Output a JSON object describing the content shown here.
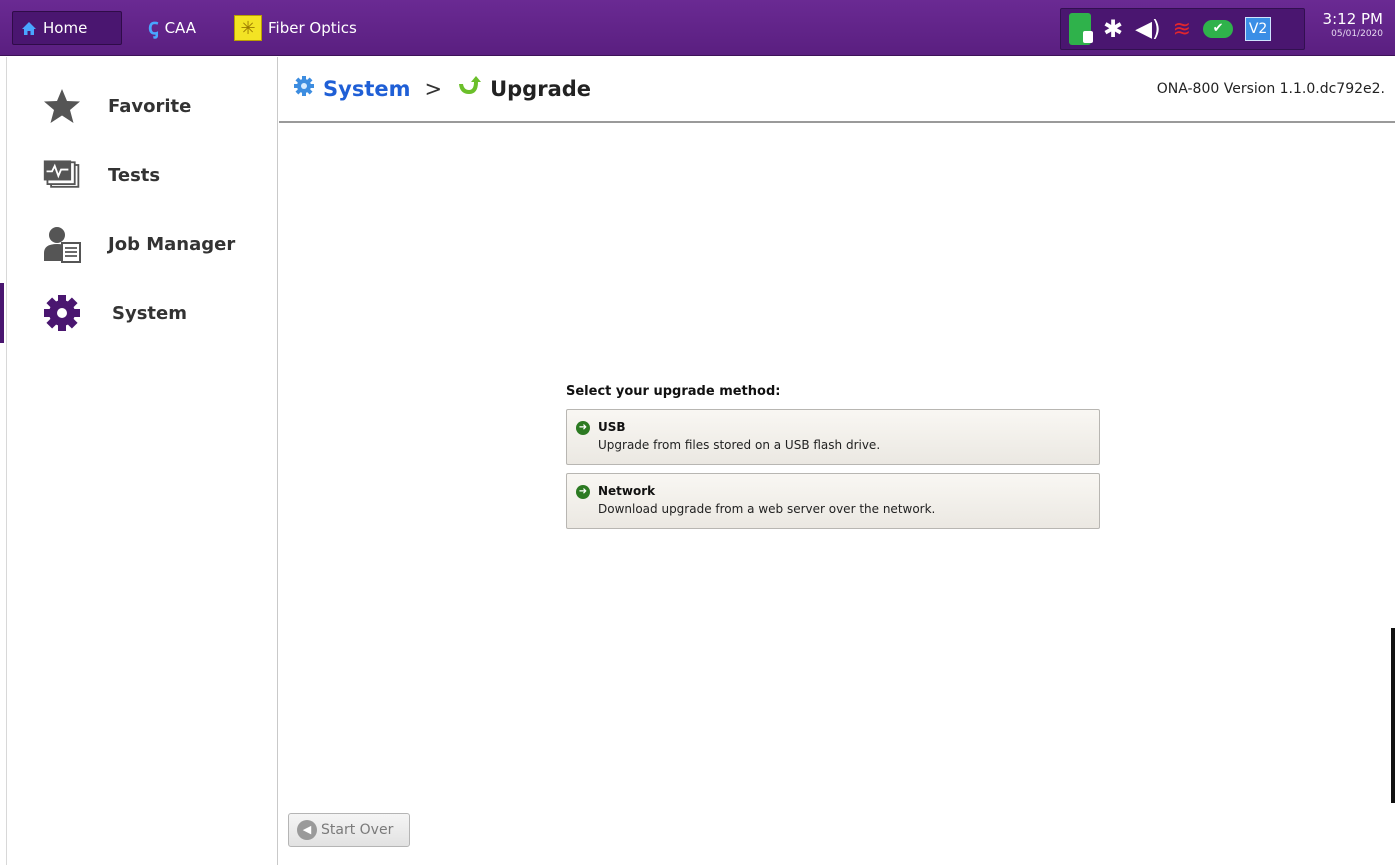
{
  "topbar": {
    "tabs": [
      {
        "label": "Home",
        "icon": "home-icon"
      },
      {
        "label": "CAA",
        "icon": "caa-icon"
      },
      {
        "label": "Fiber Optics",
        "icon": "fiber-optics-icon"
      }
    ],
    "status": {
      "icons": [
        "battery-charging-icon",
        "bluetooth-icon",
        "volume-icon",
        "wifi-disconnected-icon",
        "cloud-connected-icon",
        "v2-icon"
      ],
      "v2_label": "V2",
      "time": "3:12 PM",
      "date": "05/01/2020"
    },
    "colors": {
      "bar": "#5a1f80",
      "accent": "#4a1670"
    }
  },
  "sidebar": {
    "items": [
      {
        "label": "Favorite",
        "icon": "star-icon"
      },
      {
        "label": "Tests",
        "icon": "tests-icon"
      },
      {
        "label": "Job Manager",
        "icon": "job-manager-icon"
      },
      {
        "label": "System",
        "icon": "gear-icon",
        "active": true
      }
    ]
  },
  "header": {
    "breadcrumb": [
      "System",
      ">",
      "Upgrade"
    ],
    "version": "ONA-800 Version 1.1.0.dc792e2."
  },
  "main": {
    "prompt": "Select your upgrade method:",
    "methods": [
      {
        "title": "USB",
        "description": "Upgrade from files stored on a USB flash drive."
      },
      {
        "title": "Network",
        "description": "Download upgrade from a web server over the network."
      }
    ],
    "start_over_label": "Start Over"
  }
}
